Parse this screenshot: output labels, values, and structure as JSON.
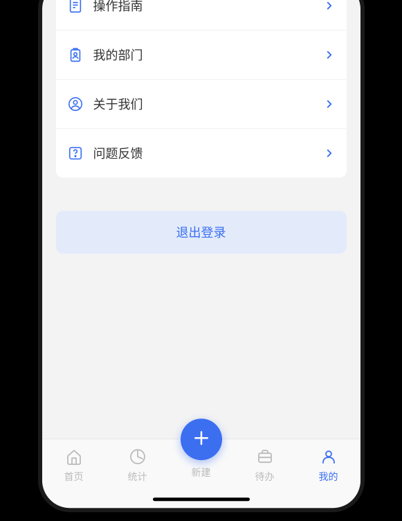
{
  "menu": {
    "items": [
      {
        "label": "操作指南"
      },
      {
        "label": "我的部门"
      },
      {
        "label": "关于我们"
      },
      {
        "label": "问题反馈"
      }
    ]
  },
  "logout": {
    "label": "退出登录"
  },
  "tabbar": {
    "home": "首页",
    "stats": "统计",
    "create": "新建",
    "todo": "待办",
    "mine": "我的"
  }
}
